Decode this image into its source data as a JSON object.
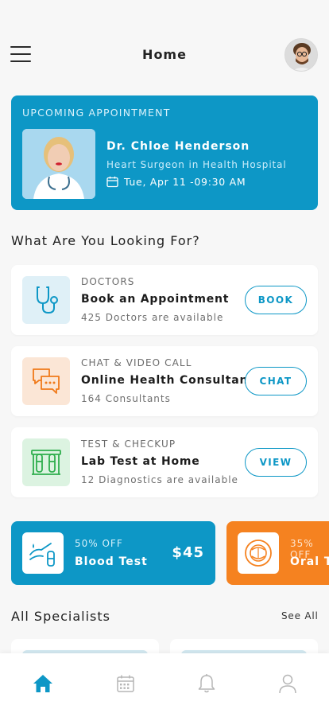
{
  "header": {
    "title": "Home"
  },
  "appointment": {
    "label": "UPCOMING APPOINTMENT",
    "doctor_name": "Dr. Chloe Henderson",
    "doctor_role": "Heart Surgeon in Health Hospital",
    "datetime": "Tue, Apr 11 -09:30 AM"
  },
  "section_title": "What Are You Looking For?",
  "services": [
    {
      "category": "DOCTORS",
      "title": "Book an Appointment",
      "subtitle": "425 Doctors are available",
      "button": "BOOK",
      "icon": "stethoscope-icon",
      "icon_bg": "#dff0f7",
      "icon_color": "#0d97c6"
    },
    {
      "category": "CHAT & VIDEO CALL",
      "title": "Online Health Consultant",
      "subtitle": "164 Consultants",
      "button": "CHAT",
      "icon": "chat-icon",
      "icon_bg": "#fbe6d6",
      "icon_color": "#f07a1a"
    },
    {
      "category": "TEST & CHECKUP",
      "title": "Lab Test at Home",
      "subtitle": "12 Diagnostics are available",
      "button": "VIEW",
      "icon": "test-tubes-icon",
      "icon_bg": "#dcf3e1",
      "icon_color": "#2fae4d"
    }
  ],
  "offers": [
    {
      "discount": "50% OFF",
      "name": "Blood Test",
      "price": "$45",
      "color": "#0d97c6",
      "icon": "blood-test-icon"
    },
    {
      "discount": "35% OFF",
      "name": "Oral Test",
      "price": "",
      "color": "#f58220",
      "icon": "oral-test-icon"
    }
  ],
  "specialists": {
    "title": "All Specialists",
    "see_all": "See All"
  },
  "nav": {
    "items": [
      "home-icon",
      "calendar-icon",
      "bell-icon",
      "profile-icon"
    ],
    "active_color": "#0d97c6",
    "inactive_color": "#b5b5b5"
  }
}
